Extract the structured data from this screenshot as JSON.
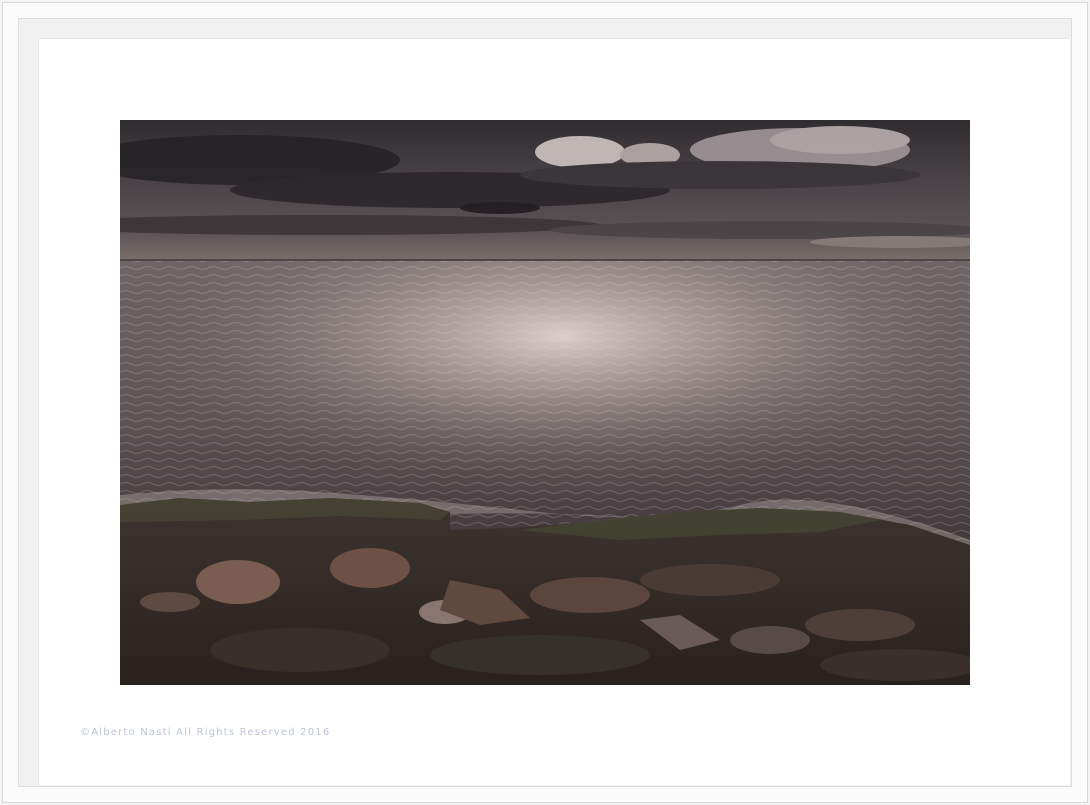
{
  "artwork": {
    "copyright": "©Alberto Nasti All Rights Reserved 2016",
    "subject_icons": [
      "sky-clouds",
      "sea-water",
      "rocky-shore"
    ]
  },
  "colors": {
    "mat": "#ffffff",
    "frame": "#f1f1f1",
    "copyright_text": "#b9c6d6",
    "sky_dark": "#2c2a2d",
    "sea_highlight": "#d8c7c3",
    "rock": "#4a3a32"
  }
}
